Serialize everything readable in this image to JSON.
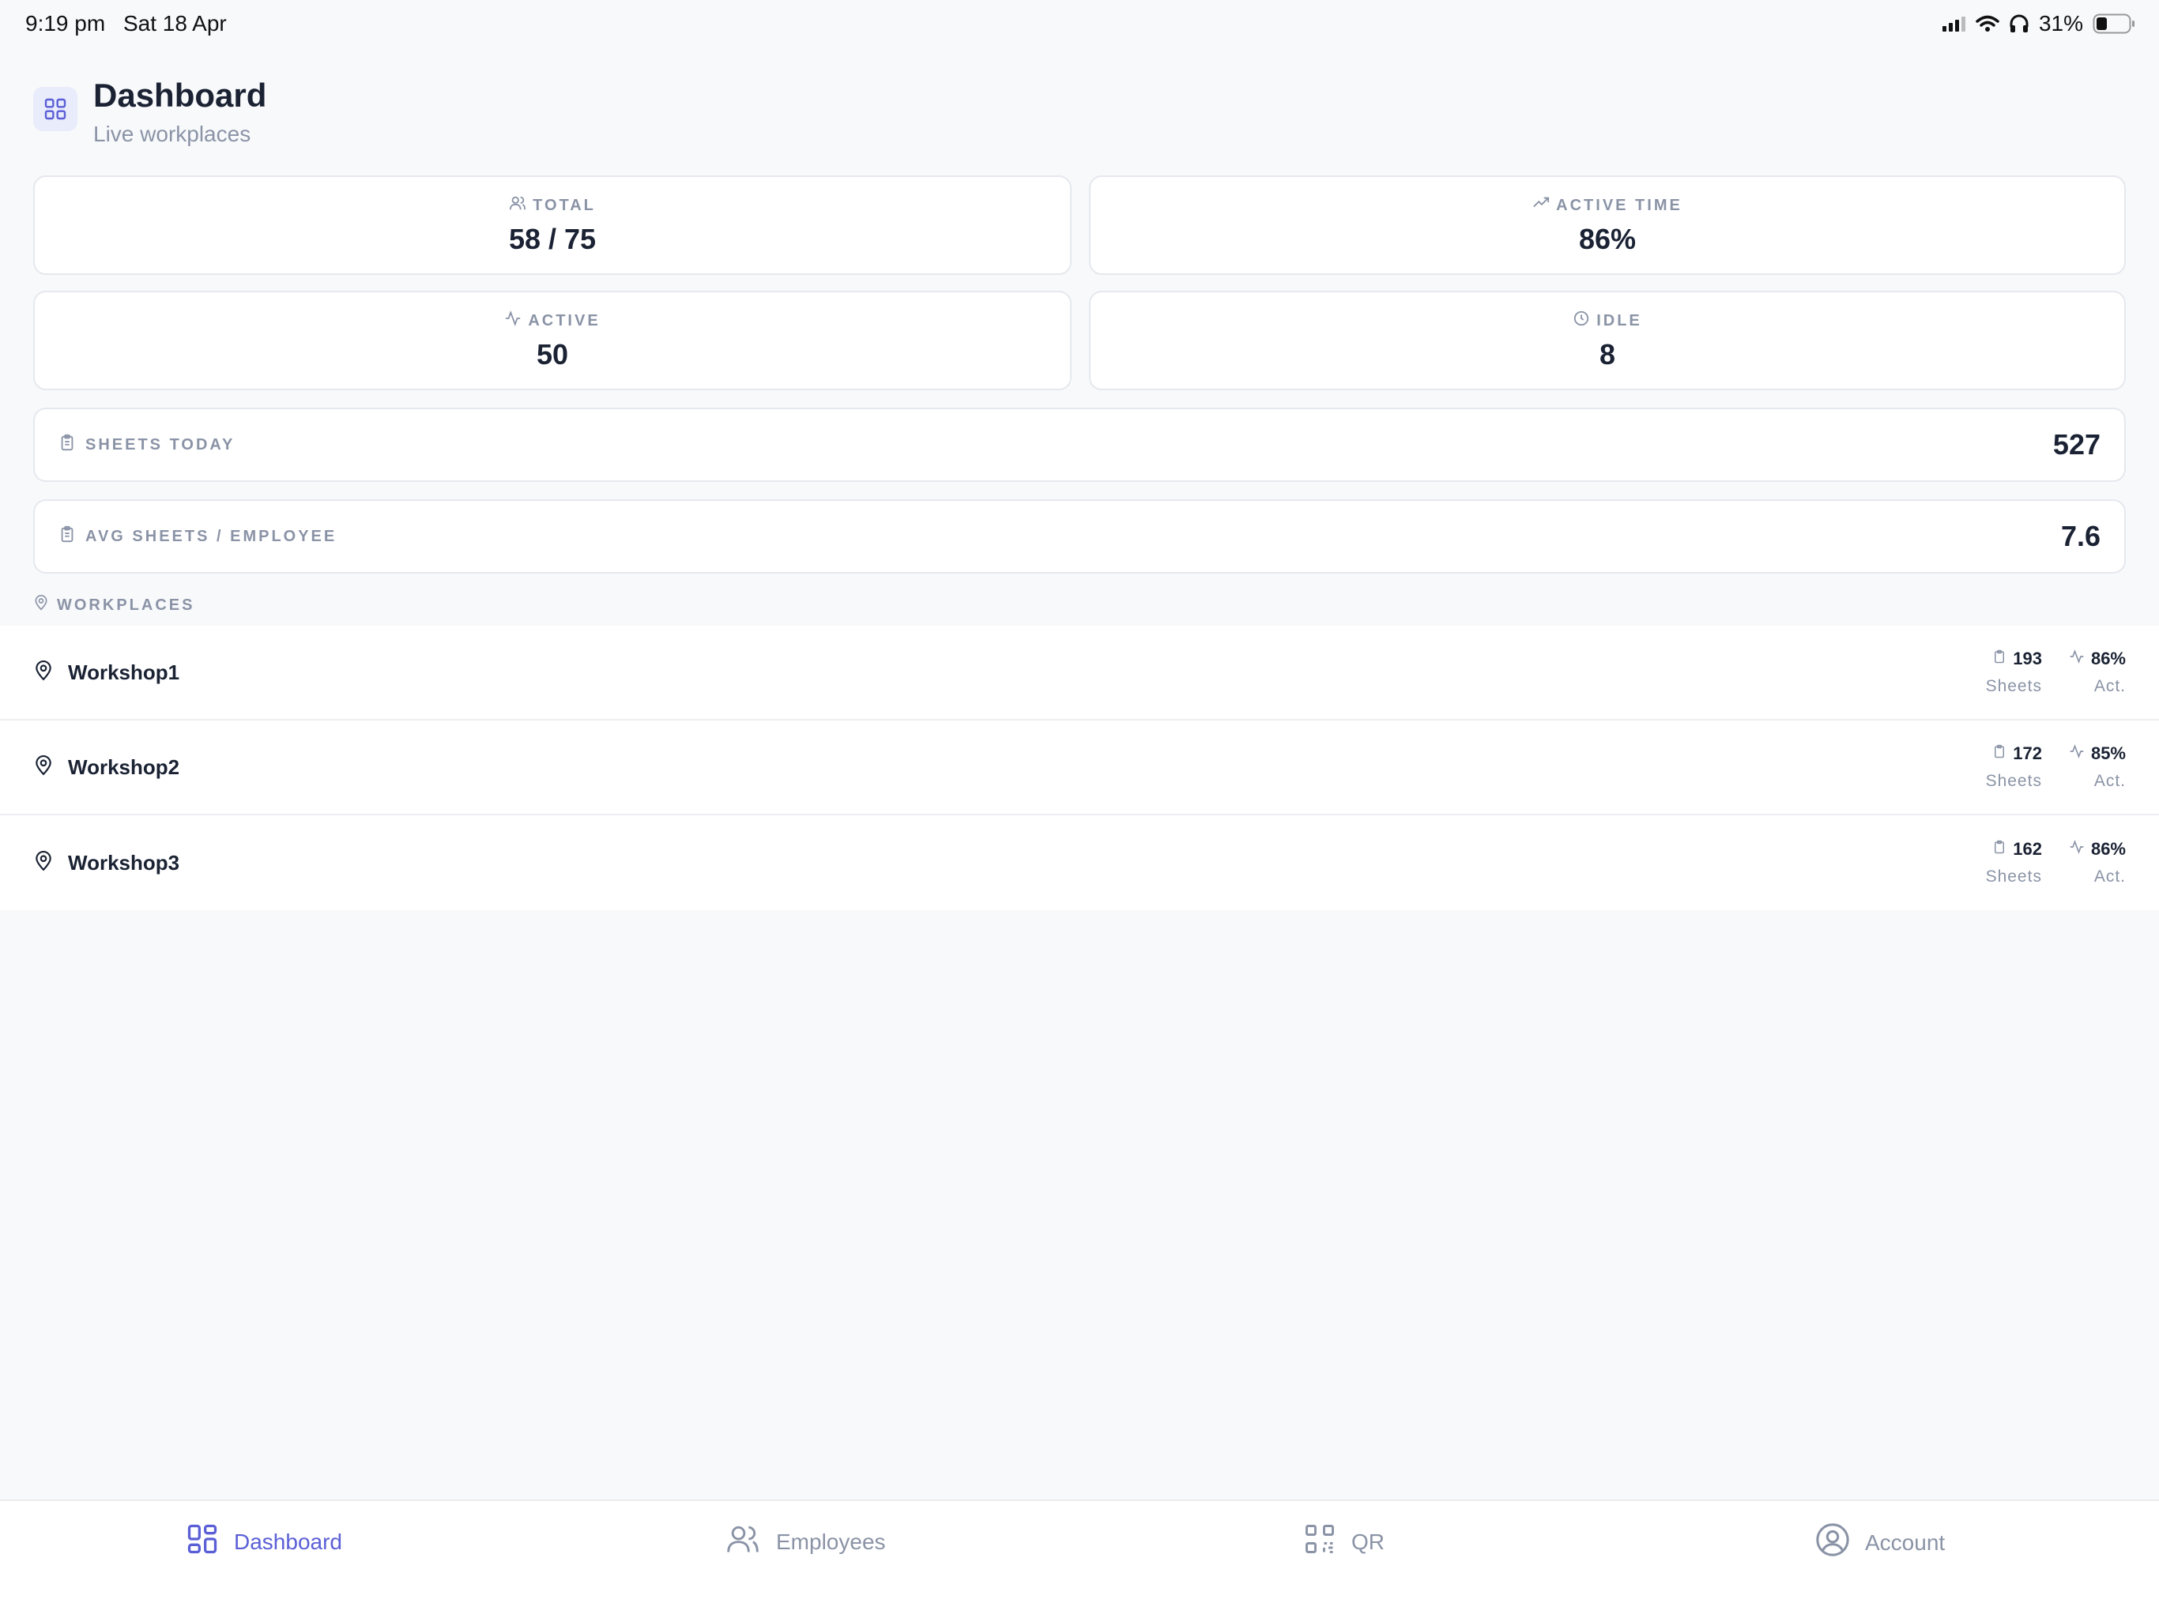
{
  "status_bar": {
    "time": "9:19 pm",
    "date": "Sat 18 Apr",
    "battery": "31%"
  },
  "header": {
    "title": "Dashboard",
    "subtitle": "Live workplaces",
    "icon": "grid-icon"
  },
  "stats": {
    "total": {
      "label": "TOTAL",
      "value": "58 / 75",
      "icon": "users-icon"
    },
    "active_time": {
      "label": "ACTIVE TIME",
      "value": "86%",
      "icon": "trending-up-icon"
    },
    "active": {
      "label": "ACTIVE",
      "value": "50",
      "icon": "activity-icon"
    },
    "idle": {
      "label": "IDLE",
      "value": "8",
      "icon": "clock-icon"
    },
    "sheets_today": {
      "label": "SHEETS TODAY",
      "value": "527",
      "icon": "clipboard-icon"
    },
    "avg_sheets": {
      "label": "AVG SHEETS / EMPLOYEE",
      "value": "7.6",
      "icon": "clipboard-icon"
    }
  },
  "workplaces": {
    "section_label": "WORKPLACES",
    "items": [
      {
        "name": "Workshop1",
        "sheets": "193",
        "sheets_label": "Sheets",
        "activity": "86%",
        "activity_label": "Act."
      },
      {
        "name": "Workshop2",
        "sheets": "172",
        "sheets_label": "Sheets",
        "activity": "85%",
        "activity_label": "Act."
      },
      {
        "name": "Workshop3",
        "sheets": "162",
        "sheets_label": "Sheets",
        "activity": "86%",
        "activity_label": "Act."
      }
    ]
  },
  "tabbar": {
    "tabs": [
      {
        "label": "Dashboard",
        "icon": "grid-icon",
        "active": true
      },
      {
        "label": "Employees",
        "icon": "users-icon",
        "active": false
      },
      {
        "label": "QR",
        "icon": "qr-code-icon",
        "active": false
      },
      {
        "label": "Account",
        "icon": "user-circle-icon",
        "active": false
      }
    ]
  },
  "colors": {
    "accent": "#5b5fd6",
    "muted": "#8a93a6",
    "text": "#1a2233",
    "background": "#f8f9fb"
  }
}
